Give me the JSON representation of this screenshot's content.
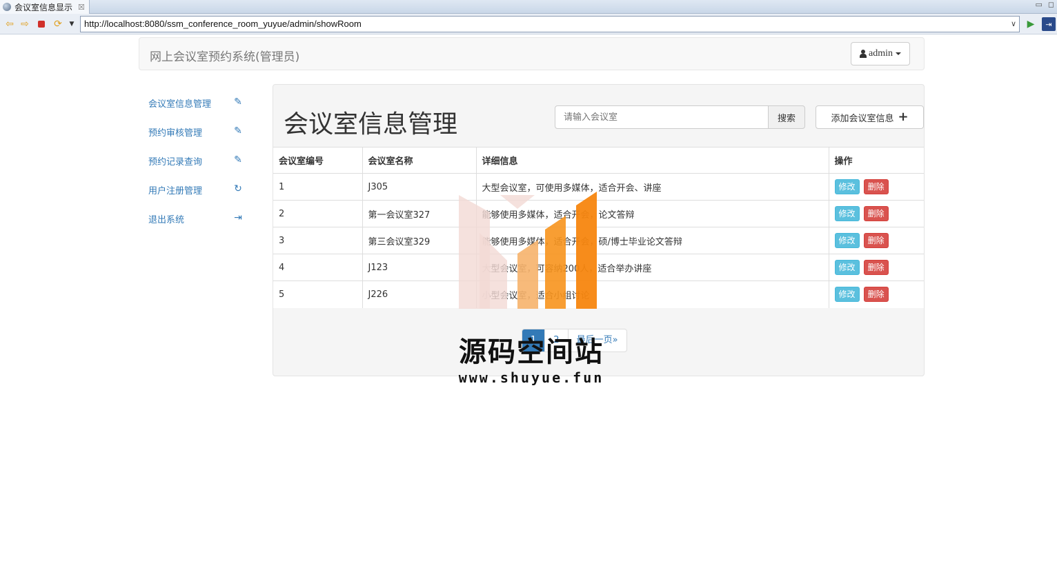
{
  "browser": {
    "tab_title": "会议室信息显示",
    "tab_close": "☒",
    "url": "http://localhost:8080/ssm_conference_room_yuyue/admin/showRoom"
  },
  "header": {
    "brand": "网上会议室预约系统(管理员)",
    "user": "admin"
  },
  "sidebar": {
    "items": [
      {
        "label": "会议室信息管理",
        "icon": "pencil-icon"
      },
      {
        "label": "预约审核管理",
        "icon": "pencil-icon"
      },
      {
        "label": "预约记录查询",
        "icon": "pencil-icon"
      },
      {
        "label": "用户注册管理",
        "icon": "refresh-icon"
      },
      {
        "label": "退出系统",
        "icon": "logout-icon"
      }
    ]
  },
  "main": {
    "title": "会议室信息管理",
    "search_placeholder": "请输入会议室",
    "search_label": "搜索",
    "add_label": "添加会议室信息",
    "table": {
      "headers": [
        "会议室编号",
        "会议室名称",
        "详细信息",
        "操作"
      ],
      "rows": [
        {
          "id": "1",
          "name": "J305",
          "detail": "大型会议室，可使用多媒体，适合开会、讲座"
        },
        {
          "id": "2",
          "name": "第一会议室327",
          "detail": "能够使用多媒体，适合开会，论文答辩"
        },
        {
          "id": "3",
          "name": "第三会议室329",
          "detail": "能够使用多媒体，适合开会，硕/博士毕业论文答辩"
        },
        {
          "id": "4",
          "name": "J123",
          "detail": "大型会议室，可容纳200人，适合举办讲座"
        },
        {
          "id": "5",
          "name": "J226",
          "detail": "小型会议室，适合小组讨论"
        }
      ],
      "edit_label": "修改",
      "delete_label": "删除"
    },
    "pagination": {
      "pages": [
        "1",
        "2"
      ],
      "current": "1",
      "last_label": "最后一页»"
    }
  },
  "watermark": {
    "text": "源码空间站",
    "url": "www.shuyue.fun"
  }
}
